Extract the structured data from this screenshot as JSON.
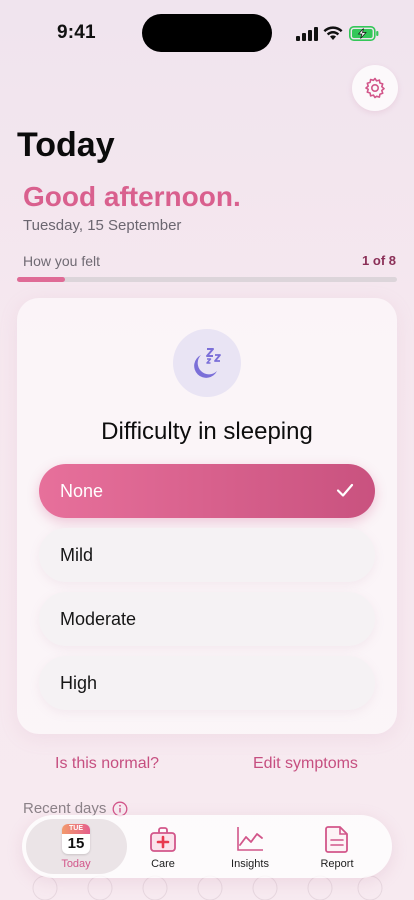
{
  "status": {
    "time": "9:41"
  },
  "header": {
    "title": "Today",
    "greeting": "Good afternoon.",
    "date": "Tuesday, 15 September"
  },
  "progress": {
    "label": "How you felt",
    "count": "1 of 8",
    "fraction": 0.125
  },
  "question": {
    "title": "Difficulty in sleeping",
    "icon": "moon-zzz-icon",
    "options": [
      {
        "label": "None",
        "selected": true
      },
      {
        "label": "Mild",
        "selected": false
      },
      {
        "label": "Moderate",
        "selected": false
      },
      {
        "label": "High",
        "selected": false
      }
    ]
  },
  "links": {
    "normal": "Is this normal?",
    "edit": "Edit symptoms"
  },
  "recent": {
    "label": "Recent days"
  },
  "tabs": [
    {
      "label": "Today",
      "icon": "calendar-icon",
      "cal_month": "TUE",
      "cal_day": "15",
      "active": true
    },
    {
      "label": "Care",
      "icon": "first-aid-kit-icon",
      "active": false
    },
    {
      "label": "Insights",
      "icon": "line-chart-icon",
      "active": false
    },
    {
      "label": "Report",
      "icon": "document-icon",
      "active": false
    }
  ],
  "colors": {
    "accent": "#d9608e",
    "accent_dark": "#c9527f",
    "battery": "#34c759"
  }
}
